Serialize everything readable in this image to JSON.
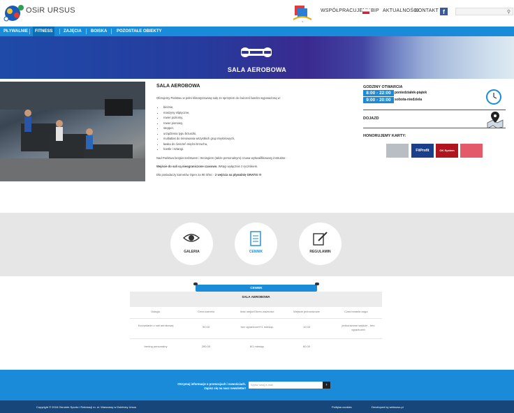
{
  "header": {
    "site_name": "OSiR URSUS",
    "nav": [
      "WSPÓŁPRACUJEMY",
      "BIP",
      "AKTUALNOŚCI",
      "KONTAKT"
    ],
    "search": {
      "placeholder": ""
    },
    "icons": [
      "osir-logo-icon",
      "partner-logo-icon",
      "bip-flag-icon",
      "facebook-icon",
      "search-icon"
    ]
  },
  "mainnav": {
    "items": [
      "PŁYWALNIE",
      "FITNESS",
      "ZAJĘCIA",
      "BOISKA",
      "POZOSTAŁE OBIEKTY"
    ],
    "active": "FITNESS"
  },
  "banner": {
    "title": "SALA AEROBOWA"
  },
  "content": {
    "title": "SALA AEROBOWA",
    "intro": "Oferujemy Państwu w pełni klimatyzowaną salę ze sprzętem do ćwiczeń bardzo wyposażoną w:",
    "equipment": [
      "bieżnie,",
      "maszyny eliptyczne,",
      "rower poziomy,",
      "rower pionowy,",
      "stepper,",
      "urządzenia typu brzuszki,",
      "multiatlas do trenowania wszystkich grup mięśniowych,",
      "ławka do ćwiczeń mięśni brzucha,",
      "hantle i sztangi."
    ],
    "supervision": "Nad Państwa bezpieczeństwem i treningiem (także personalnym) czuwa wykwalifikowany instruktor.",
    "access_bold": "Wejście do sali są nieograniczone czasowo.",
    "access_rest": " Wstęp wyłącznie z ręcznikiem.",
    "promo_plain": "Dla posiadaczy karnetów Open za 90 zł/mc - ",
    "promo_bold": "2 wejścia na pływalnię GRATIS !!!"
  },
  "sidebar": {
    "hours_title": "GODZINY OTWARCIA",
    "hours": [
      {
        "time": "8:00 - 22:00",
        "days": "poniedziałek-piątek"
      },
      {
        "time": "9:00 - 20:00",
        "days": "sobota-niedziela"
      }
    ],
    "directions_title": "DOJAZD",
    "cards_title": "HONORUJEMY KARTY:",
    "cards": [
      {
        "name": "card-1",
        "color": "#b8bec4"
      },
      {
        "name": "FitProfit",
        "color": "#1c3f8c"
      },
      {
        "name": "OK System",
        "color": "#b0141e"
      },
      {
        "name": "card-4",
        "color": "#e35a6a"
      }
    ]
  },
  "links": {
    "items": [
      "GALERIA",
      "CENNIK",
      "REGULAMIN"
    ],
    "active": "CENNIK"
  },
  "pricing": {
    "tab": "CENNIK",
    "title": "SALA AEROBOWA",
    "columns": [
      "Usługa",
      "Cena karnetu",
      "Ilość wejść/Okres ważności",
      "Wejście jednorazowe",
      "Czas trwania zajęć"
    ],
    "rows": [
      [
        "Korzystanie z sali aerobowej",
        "90,00",
        "bez ograniczeń*/1 miesiąc",
        "10,00",
        "jednorazowe wejście - bez ograniczeń"
      ],
      [
        "trening personalny",
        "280,00",
        "8/1 miesiąc",
        "60,00",
        ""
      ]
    ]
  },
  "newsletter": {
    "line1": "Otrzymuj informacje o promocjach i nowościach.",
    "line2": "Zapisz się na nasz newsletter!",
    "placeholder": "Wpisz swój e-mail",
    "button": "›"
  },
  "footer": {
    "copyright": "Copyright © 2016 Ośrodek Sportu i Rekreacji m. st. Warszawy w Dzielnicy Ursus",
    "cookies": "Polityka cookies",
    "developer": "Developed by websoso.pl"
  },
  "colors": {
    "brand_blue": "#1a8bd8",
    "footer_blue": "#16467a"
  }
}
